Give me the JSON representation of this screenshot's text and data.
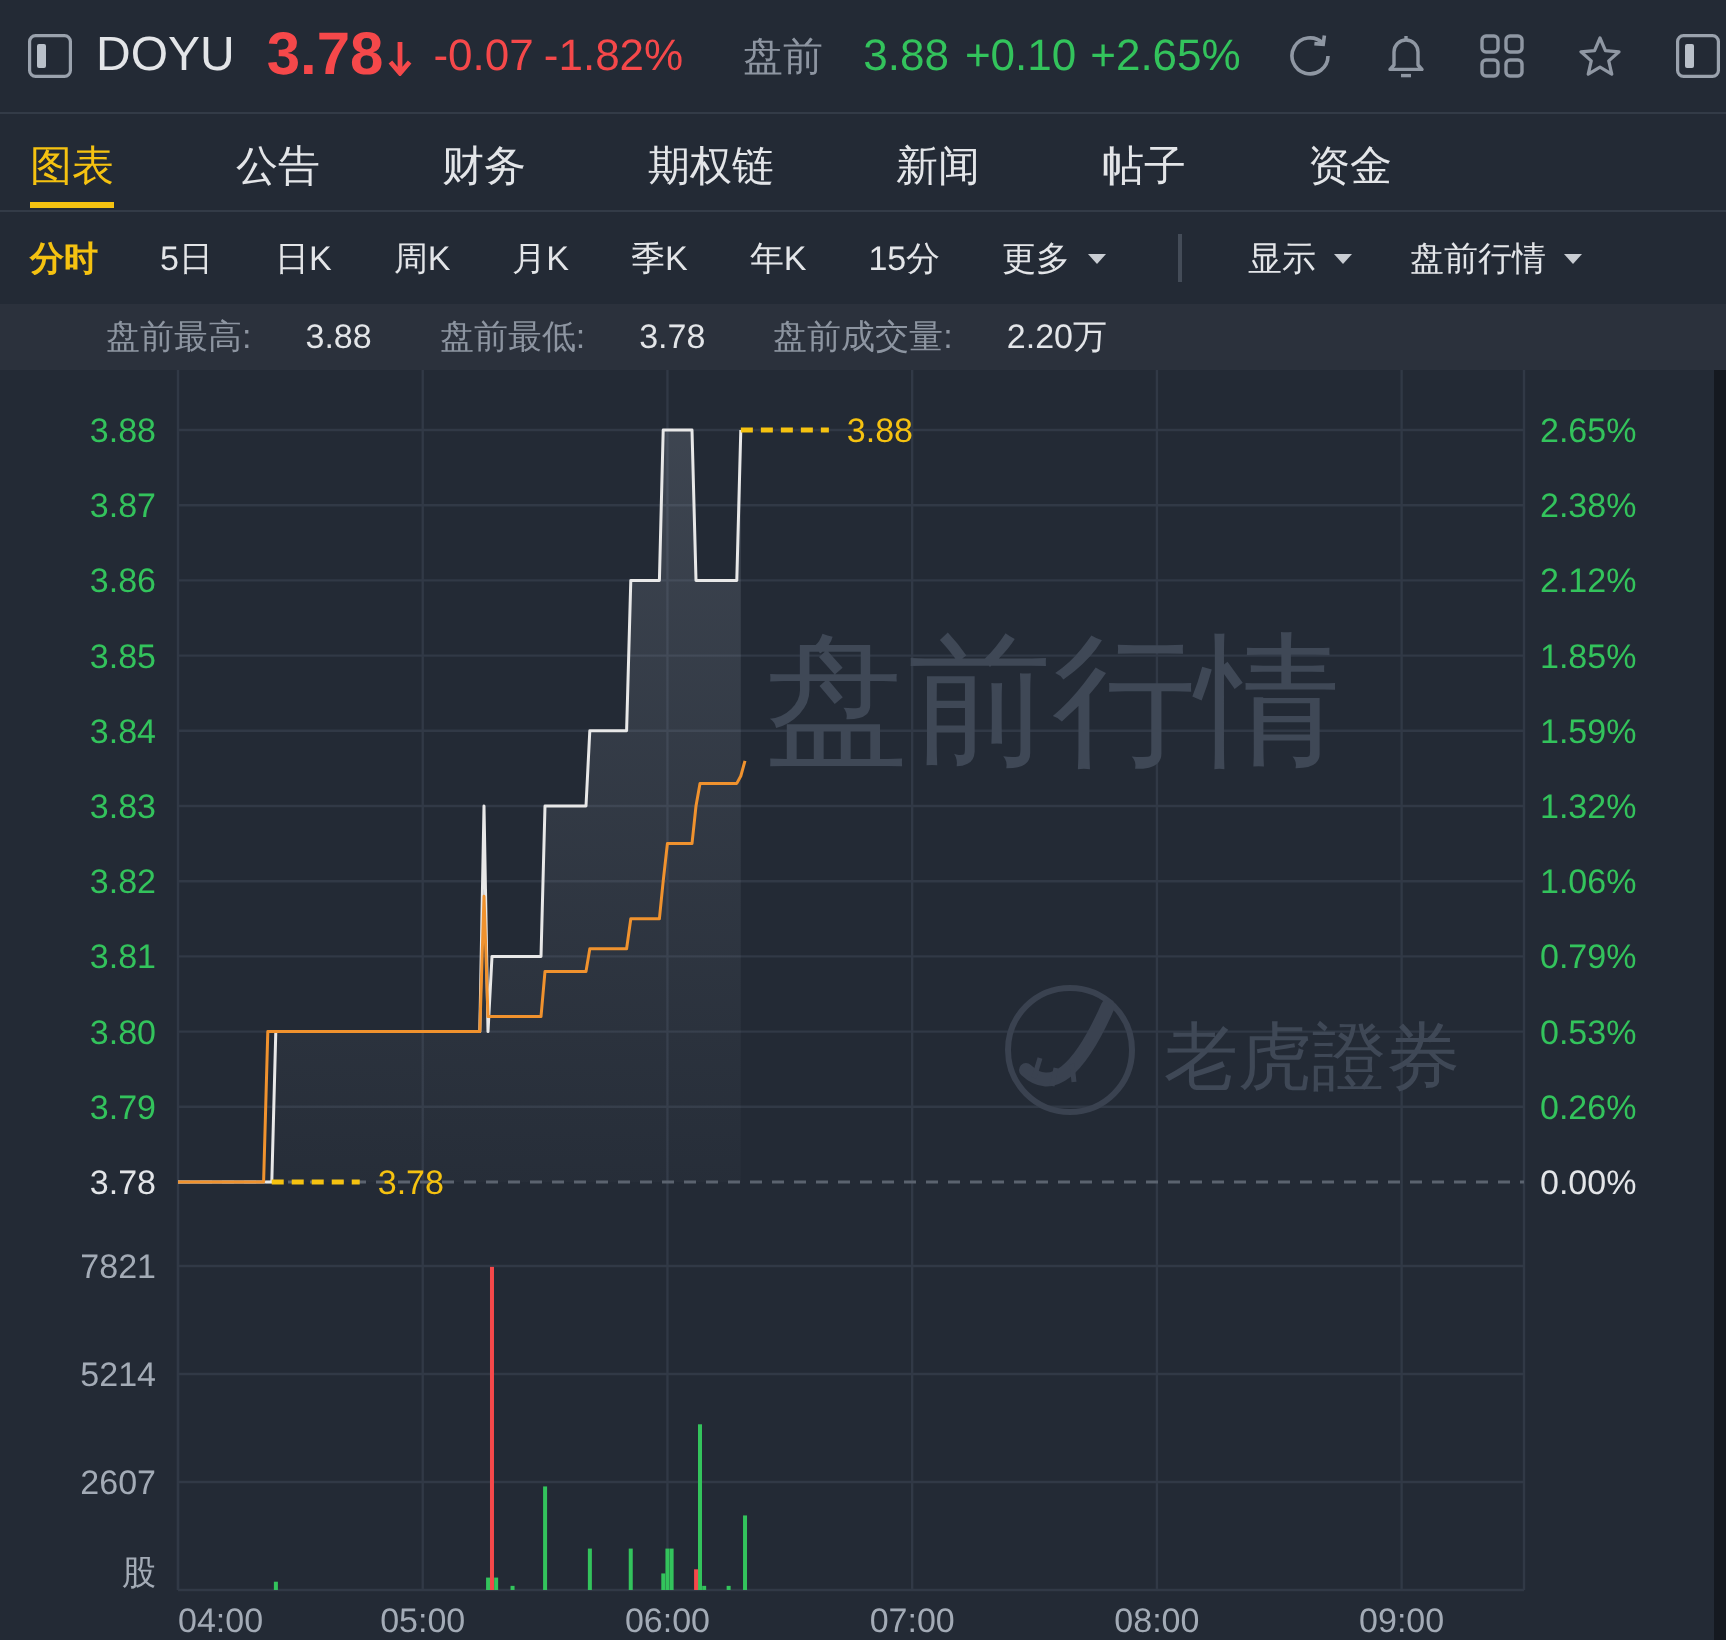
{
  "quote": {
    "symbol": "DOYU",
    "price": "3.78",
    "down": true,
    "change": "-0.07",
    "change_pct": "-1.82%"
  },
  "premarket": {
    "label": "盘前",
    "price": "3.88",
    "down": false,
    "change": "+0.10",
    "change_pct": "+2.65%"
  },
  "tabs": [
    {
      "label": "图表",
      "selected": true
    },
    {
      "label": "公告",
      "selected": false
    },
    {
      "label": "财务",
      "selected": false
    },
    {
      "label": "期权链",
      "selected": false
    },
    {
      "label": "新闻",
      "selected": false
    },
    {
      "label": "帖子",
      "selected": false
    },
    {
      "label": "资金",
      "selected": false
    }
  ],
  "periods": [
    {
      "label": "分时",
      "kind": "option",
      "selected": true
    },
    {
      "label": "5日",
      "kind": "option",
      "selected": false
    },
    {
      "label": "日K",
      "kind": "option",
      "selected": false
    },
    {
      "label": "周K",
      "kind": "option",
      "selected": false
    },
    {
      "label": "月K",
      "kind": "option",
      "selected": false
    },
    {
      "label": "季K",
      "kind": "option",
      "selected": false
    },
    {
      "label": "年K",
      "kind": "option",
      "selected": false
    },
    {
      "label": "15分",
      "kind": "option",
      "selected": false
    },
    {
      "label": "更多",
      "kind": "dropdown",
      "selected": false
    }
  ],
  "view_menus": [
    {
      "label": "显示"
    },
    {
      "label": "盘前行情"
    }
  ],
  "stats": [
    {
      "label": "盘前最高:",
      "value": "3.88"
    },
    {
      "label": "盘前最低:",
      "value": "3.78"
    },
    {
      "label": "盘前成交量:",
      "value": "2.20万"
    }
  ],
  "price_chart": {
    "watermarks": [
      {
        "kind": "text",
        "text": "盘前行情"
      },
      {
        "kind": "logo",
        "text": "老虎證券"
      }
    ],
    "percent_ticks": [
      "2.65%",
      "2.38%",
      "2.12%",
      "1.85%",
      "1.59%",
      "1.32%",
      "1.06%",
      "0.79%",
      "0.53%",
      "0.26%",
      "0.00%"
    ],
    "chart_data": {
      "type": "line",
      "grid": true,
      "xlim": [
        4,
        9.5
      ],
      "ylim": [
        3.78,
        3.88
      ],
      "yticks": [
        {
          "value": 3.88,
          "label": "3.88"
        },
        {
          "value": 3.87,
          "label": "3.87"
        },
        {
          "value": 3.86,
          "label": "3.86"
        },
        {
          "value": 3.85,
          "label": "3.85"
        },
        {
          "value": 3.84,
          "label": "3.84"
        },
        {
          "value": 3.83,
          "label": "3.83"
        },
        {
          "value": 3.82,
          "label": "3.82"
        },
        {
          "value": 3.81,
          "label": "3.81"
        },
        {
          "value": 3.8,
          "label": "3.80"
        },
        {
          "value": 3.79,
          "label": "3.79"
        },
        {
          "value": 3.78,
          "label": "3.78"
        }
      ],
      "x": [
        4,
        4.35,
        4.367,
        4.383,
        4.4,
        5.233,
        5.25,
        5.267,
        5.283,
        5.483,
        5.5,
        5.667,
        5.683,
        5.833,
        5.85,
        5.967,
        5.983,
        6,
        6.1,
        6.117,
        6.133,
        6.283,
        6.3,
        6.317
      ],
      "series": [
        {
          "type": "area",
          "color": "#e8e8e8",
          "values": [
            3.78,
            3.78,
            3.78,
            3.78,
            3.8,
            3.8,
            3.83,
            3.8,
            3.81,
            3.81,
            3.83,
            3.83,
            3.84,
            3.84,
            3.86,
            3.86,
            3.88,
            3.88,
            3.88,
            3.86,
            3.86,
            3.86,
            3.88,
            null
          ]
        },
        {
          "color": "#f0922e",
          "values": [
            3.78,
            3.78,
            3.8,
            3.8,
            3.8,
            3.8,
            3.818,
            3.802,
            3.802,
            3.802,
            3.808,
            3.808,
            3.811,
            3.811,
            3.815,
            3.815,
            3.82,
            3.825,
            3.825,
            3.83,
            3.833,
            3.833,
            3.834,
            3.836
          ]
        }
      ],
      "ref_lines": [
        {
          "axis": "y",
          "value": 3.78
        }
      ],
      "annotations": [
        "3.88",
        "3.78"
      ]
    }
  },
  "volume_chart": {
    "chart_data": {
      "type": "bar",
      "grid": true,
      "xlim": [
        4,
        9.5
      ],
      "ylim": [
        0,
        7821
      ],
      "ylabel": "股",
      "yticks": [
        {
          "value": 2607,
          "label": "2607"
        },
        {
          "value": 5214,
          "label": "5214"
        },
        {
          "value": 7821,
          "label": "7821"
        }
      ],
      "xticks": [
        {
          "value": 4,
          "label": "04:00"
        },
        {
          "value": 5,
          "label": "05:00"
        },
        {
          "value": 6,
          "label": "06:00"
        },
        {
          "value": 7,
          "label": "07:00"
        },
        {
          "value": 8,
          "label": "08:00"
        },
        {
          "value": 9,
          "label": "09:00"
        }
      ],
      "x": [
        4.4,
        5.267,
        5.283,
        5.3,
        5.367,
        5.5,
        5.683,
        5.85,
        5.983,
        6,
        6.017,
        6.117,
        6.133,
        6.15,
        6.25,
        6.317
      ],
      "series": [
        {
          "color": "#33c35c",
          "values": [
            200,
            300,
            null,
            300,
            100,
            2500,
            1000,
            1000,
            400,
            1000,
            1000,
            null,
            4000,
            100,
            100,
            1800
          ]
        },
        {
          "color": "#f5484a",
          "values": [
            null,
            null,
            7800,
            null,
            null,
            null,
            null,
            null,
            null,
            null,
            null,
            500,
            null,
            null,
            null,
            null
          ]
        }
      ]
    }
  }
}
